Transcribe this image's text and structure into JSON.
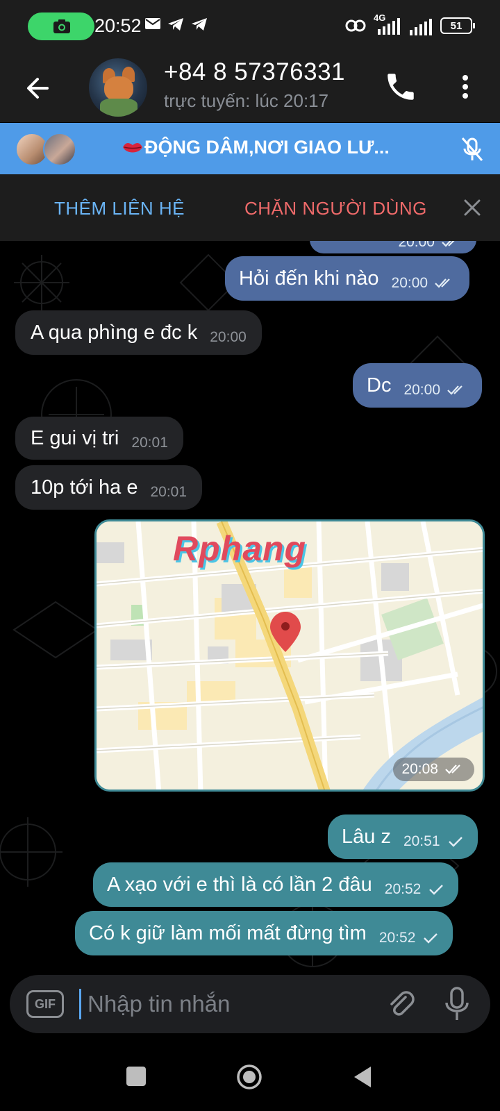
{
  "status_bar": {
    "time": "20:52",
    "battery": "51",
    "network": "4G"
  },
  "header": {
    "contact_name": "+84 8 57376331",
    "contact_status": "trực tuyến: lúc 20:17"
  },
  "group_bar": {
    "title": "ĐỘNG DÂM,NƠI GIAO LƯ..."
  },
  "action_bar": {
    "add_contact": "THÊM LIÊN HỆ",
    "block_user": "CHẶN NGƯỜI DÙNG"
  },
  "messages": [
    {
      "text": "Hỏi đến khi nào",
      "time": "20:00",
      "direction": "out",
      "status": "read"
    },
    {
      "text": "A qua phìng e đc k",
      "time": "20:00",
      "direction": "in"
    },
    {
      "text": "Dc",
      "time": "20:00",
      "direction": "out",
      "status": "read"
    },
    {
      "text": "E gui vị tri",
      "time": "20:01",
      "direction": "in"
    },
    {
      "text": "10p tới ha e",
      "time": "20:01",
      "direction": "in"
    },
    {
      "text": "Lâu z",
      "time": "20:51",
      "direction": "out",
      "status": "sent"
    },
    {
      "text": "A xạo với e thì là có lần 2 đâu",
      "time": "20:52",
      "direction": "out",
      "status": "sent"
    },
    {
      "text": "Có k giữ làm mối mất đừng tìm",
      "time": "20:52",
      "direction": "out",
      "status": "sent"
    }
  ],
  "partial_top": {
    "time": "20:00"
  },
  "map_message": {
    "logo": "Rphang",
    "time": "20:08",
    "status": "read"
  },
  "input": {
    "placeholder": "Nhập tin nhắn",
    "gif_label": "GIF"
  },
  "colors": {
    "accent": "#4f9be8",
    "out_bubble_blue": "#4f6b9f",
    "out_bubble_teal": "#3f8a96",
    "in_bubble": "#232427",
    "block_red": "#ef6a6a"
  }
}
